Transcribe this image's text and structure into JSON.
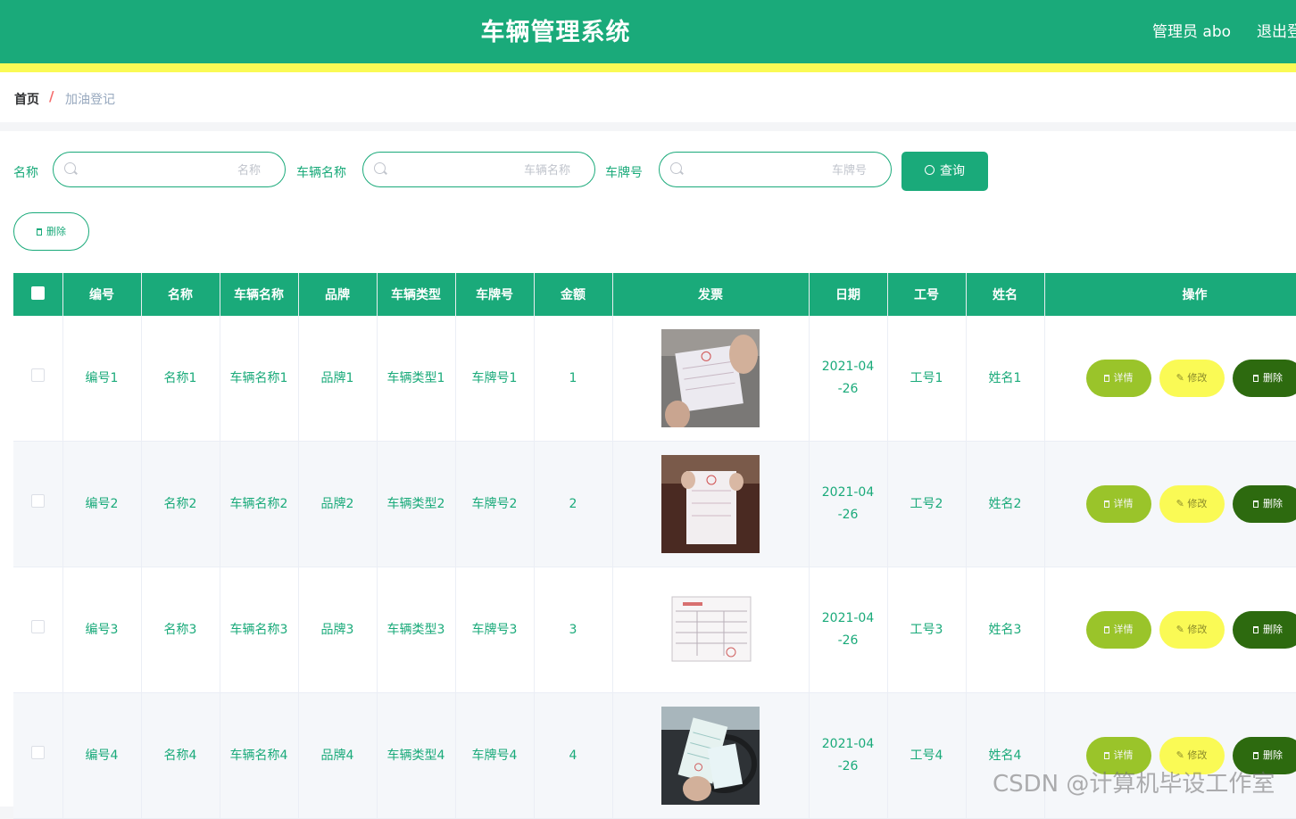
{
  "header": {
    "title": "车辆管理系统",
    "user": "管理员 abo",
    "logout": "退出登录"
  },
  "breadcrumb": {
    "home": "首页",
    "separator": "/",
    "current": "加油登记"
  },
  "search": {
    "name_label": "名称",
    "name_placeholder": "名称",
    "vehicle_label": "车辆名称",
    "vehicle_placeholder": "车辆名称",
    "plate_label": "车牌号",
    "plate_placeholder": "车牌号",
    "query_button": "查询"
  },
  "toolbar": {
    "delete_button": "删除"
  },
  "table": {
    "headers": [
      "编号",
      "名称",
      "车辆名称",
      "品牌",
      "车辆类型",
      "车牌号",
      "金额",
      "发票",
      "日期",
      "工号",
      "姓名",
      "操作"
    ],
    "actions": {
      "detail": "详情",
      "edit": "修改",
      "delete": "删除"
    },
    "rows": [
      {
        "id": "编号1",
        "name": "名称1",
        "vehicle": "车辆名称1",
        "brand": "品牌1",
        "type": "车辆类型1",
        "plate": "车牌号1",
        "amount": "1",
        "date": "2021-04-26",
        "emp_no": "工号1",
        "emp_name": "姓名1"
      },
      {
        "id": "编号2",
        "name": "名称2",
        "vehicle": "车辆名称2",
        "brand": "品牌2",
        "type": "车辆类型2",
        "plate": "车牌号2",
        "amount": "2",
        "date": "2021-04-26",
        "emp_no": "工号2",
        "emp_name": "姓名2"
      },
      {
        "id": "编号3",
        "name": "名称3",
        "vehicle": "车辆名称3",
        "brand": "品牌3",
        "type": "车辆类型3",
        "plate": "车牌号3",
        "amount": "3",
        "date": "2021-04-26",
        "emp_no": "工号3",
        "emp_name": "姓名3"
      },
      {
        "id": "编号4",
        "name": "名称4",
        "vehicle": "车辆名称4",
        "brand": "品牌4",
        "type": "车辆类型4",
        "plate": "车牌号4",
        "amount": "4",
        "date": "2021-04-26",
        "emp_no": "工号4",
        "emp_name": "姓名4"
      }
    ]
  },
  "watermark": "CSDN @计算机毕设工作室",
  "colors": {
    "primary": "#1aaa7a",
    "accent_yellow": "#fafa55",
    "detail_green": "#9ac42a",
    "delete_dark": "#2d6a0f"
  },
  "icons": [
    "search-icon",
    "delete-icon",
    "detail-icon",
    "edit-icon"
  ]
}
